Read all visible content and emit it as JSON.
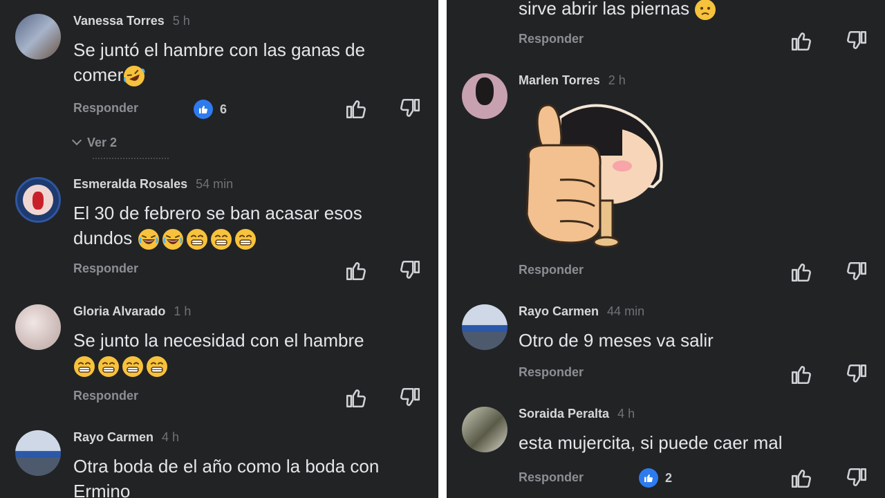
{
  "left_panel": {
    "comments": [
      {
        "author": "Vanessa Torres",
        "time": "5 h",
        "text": "Se juntó el hambre con las ganas de comer",
        "reply_label": "Responder",
        "reaction_count": "6",
        "view_replies": "Ver 2"
      },
      {
        "author": "Esmeralda Rosales",
        "time": "54 min",
        "text": "El 30 de febrero se ban acasar esos dundos",
        "reply_label": "Responder"
      },
      {
        "author": "Gloria Alvarado",
        "time": "1 h",
        "text": "Se junto la necesidad con el hambre",
        "reply_label": "Responder"
      },
      {
        "author": "Rayo Carmen",
        "time": "4 h",
        "text": "Otra boda de el año como la boda con Ermino"
      }
    ]
  },
  "right_panel": {
    "partial_text": "sirve abrir las piernas",
    "partial_reply_label": "Responder",
    "comments": [
      {
        "author": "Marlen Torres",
        "time": "2 h",
        "sticker": "thumbs-up-sticker",
        "reply_label": "Responder"
      },
      {
        "author": "Rayo Carmen",
        "time": "44 min",
        "text": "Otro de 9 meses va salir",
        "reply_label": "Responder"
      },
      {
        "author": "Soraida Peralta",
        "time": "4 h",
        "text": "esta mujercita, si puede caer mal",
        "reply_label": "Responder",
        "reaction_count": "2"
      }
    ]
  },
  "icons": {
    "like": "thumbs-up-outline-icon",
    "dislike": "thumbs-down-outline-icon",
    "reaction": "like-reaction-icon"
  },
  "colors": {
    "background": "#222325",
    "divider": "#ffffff",
    "reaction_blue": "#2e7bf0",
    "text": "#e4e6e9",
    "muted": "#8b8e93"
  }
}
